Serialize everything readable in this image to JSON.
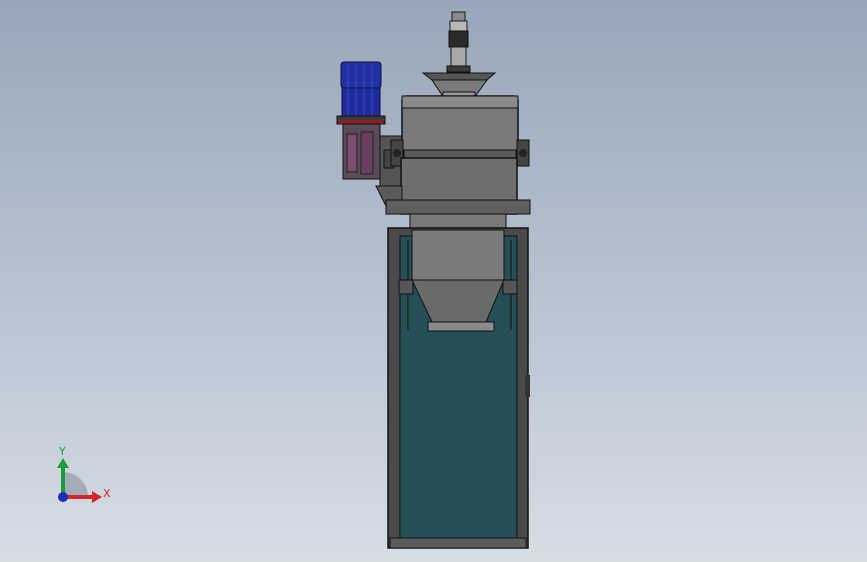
{
  "viewport": {
    "background_top": "#97a6b9",
    "background_bottom": "#d6dde5"
  },
  "model": {
    "icon": "mixer-machine-icon",
    "frame_color": "#4a4a4a",
    "body_color": "#6e6e6e",
    "panel_color": "#234f55",
    "motor_color": "#1f2a9c"
  },
  "triad": {
    "x_label": "X",
    "y_label": "Y",
    "x_color": "#d3272b",
    "y_color": "#1f9b3a",
    "z_color": "#1a2fb5"
  }
}
